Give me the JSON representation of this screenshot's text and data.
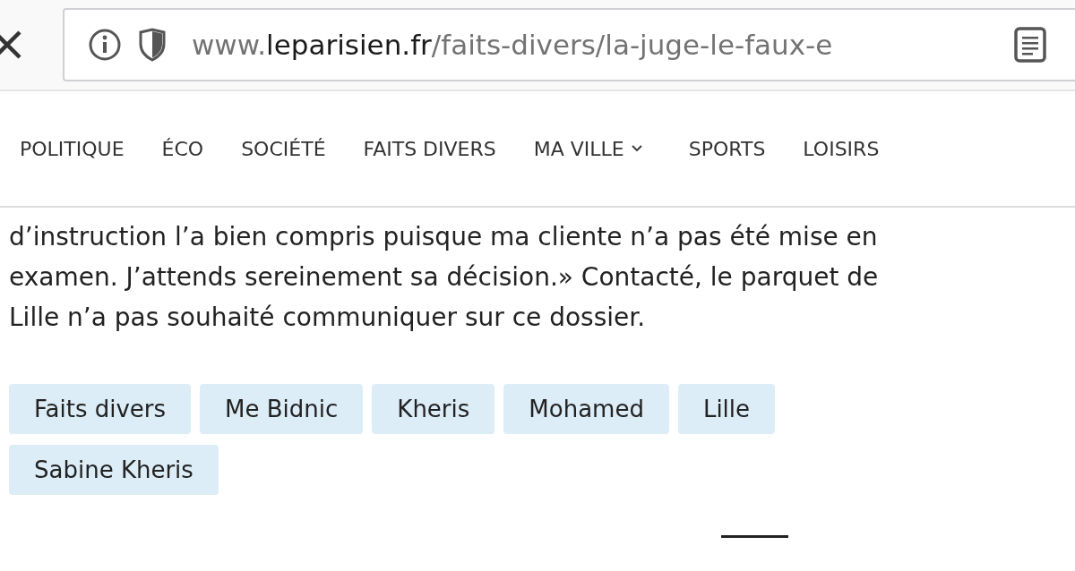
{
  "browser": {
    "url_prefix": "www.",
    "url_domain": "leparisien.fr",
    "url_path": "/faits-divers/la-juge-le-faux-e"
  },
  "nav": [
    {
      "label": "POLITIQUE",
      "has_menu": false
    },
    {
      "label": "ÉCO",
      "has_menu": false
    },
    {
      "label": "SOCIÉTÉ",
      "has_menu": false
    },
    {
      "label": "FAITS DIVERS",
      "has_menu": false
    },
    {
      "label": "MA VILLE",
      "has_menu": true
    },
    {
      "label": "SPORTS",
      "has_menu": false
    },
    {
      "label": "LOISIRS",
      "has_menu": false
    }
  ],
  "article": {
    "paragraph": "d’instruction l’a bien compris puisque ma cliente n’a pas été mise en examen. J’attends sereinement sa décision.» Contacté, le parquet de Lille n’a pas souhaité communiquer sur ce dossier."
  },
  "tags": [
    "Faits divers",
    "Me Bidnic",
    "Kheris",
    "Mohamed",
    "Lille",
    "Sabine Kheris"
  ]
}
